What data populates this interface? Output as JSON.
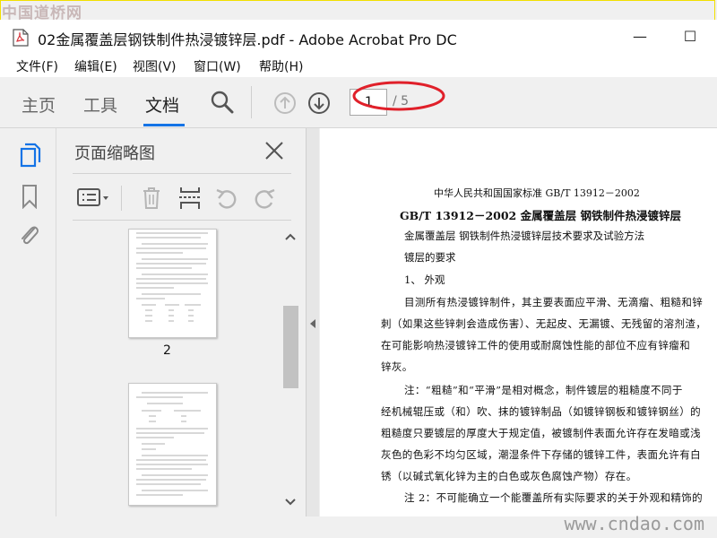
{
  "watermarks": {
    "top": "中国道桥网",
    "bottom": "www.cndao.com"
  },
  "window": {
    "title": "02金属覆盖层钢铁制件热浸镀锌层.pdf - Adobe Acrobat Pro DC",
    "minimize": "—",
    "maximize": "☐"
  },
  "menu": [
    "文件(F)",
    "编辑(E)",
    "视图(V)",
    "窗口(W)",
    "帮助(H)"
  ],
  "toolbar": {
    "tabs": [
      "主页",
      "工具",
      "文档"
    ],
    "active_tab": "文档",
    "page_current": "1",
    "page_total": "/ 5"
  },
  "sidebar": {
    "title": "页面缩略图",
    "thumb_label": "2"
  },
  "document": {
    "line1": "中华人民共和国国家标准 GB/T 13912－2002",
    "line2": "GB/T 13912－2002 金属覆盖层  钢铁制件热浸镀锌层",
    "line3": "金属覆盖层  钢铁制件热浸镀锌层技术要求及试验方法",
    "line4": "镀层的要求",
    "line5": "1、  外观",
    "para": [
      "目测所有热浸镀锌制件，其主要表面应平滑、无滴瘤、粗糙和锌",
      "刺（如果这些锌刺会造成伤害）、无起皮、无漏镀、无残留的溶剂渣，",
      "在可能影响热浸镀锌工件的使用或耐腐蚀性能的部位不应有锌瘤和",
      "锌灰。",
      "注：“粗糙”和“平滑”是相对概念，制件镀层的粗糙度不同于",
      "经机械辊压或（和）吹、抹的镀锌制品（如镀锌钢板和镀锌钢丝）的",
      "粗糙度只要镀层的厚度大于规定值，被镀制件表面允许存在发暗或浅",
      "灰色的色彩不均匀区域，潮湿条件下存储的镀锌工件，表面允许有白",
      "锈（以碱式氧化锌为主的白色或灰色腐蚀产物）存在。",
      "注 2：不可能确立一个能覆盖所有实际要求的关于外观和精饰的"
    ]
  },
  "colors": {
    "accent": "#1473e6",
    "annotation": "#e0202a",
    "frame": "#f2e000"
  }
}
